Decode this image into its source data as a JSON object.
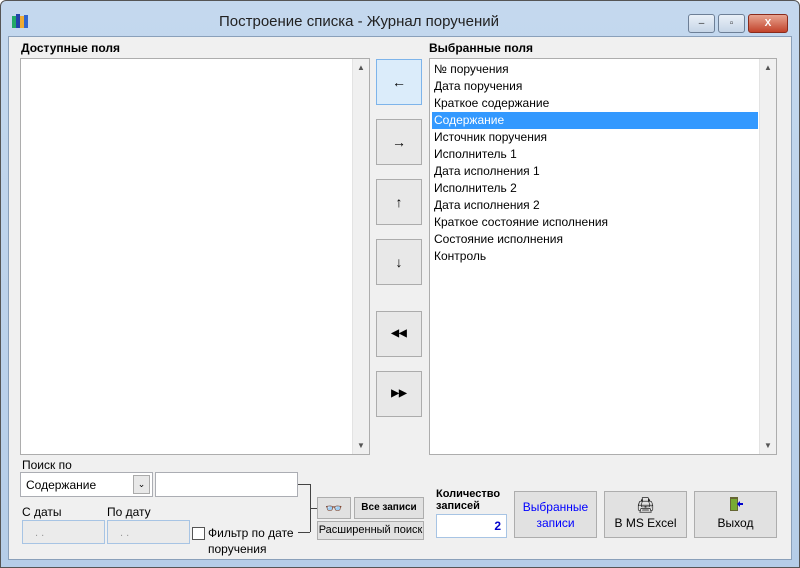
{
  "window": {
    "title": "Построение списка - Журнал поручений",
    "minimize": "–",
    "maximize": "▫",
    "close": "X"
  },
  "available": {
    "label": "Доступные поля",
    "items": []
  },
  "selected": {
    "label": "Выбранные поля",
    "items": [
      "№ поручения",
      "Дата поручения",
      "Краткое содержание",
      "Содержание",
      "Источник поручения",
      "Исполнитель 1",
      "Дата исполнения 1",
      "Исполнитель 2",
      "Дата исполнения 2",
      "Краткое состояние исполнения",
      "Состояние исполнения",
      "Контроль"
    ],
    "selected_index": 3
  },
  "arrows": {
    "add": "←",
    "remove": "→",
    "up": "↑",
    "down": "↓",
    "add_all": "◀◀",
    "remove_all": "▶▶"
  },
  "search": {
    "label": "Поиск по",
    "field_value": "Содержание",
    "text_value": "",
    "from_label": "С даты",
    "to_label": "По дату",
    "from_value": ". .",
    "to_value": ". .",
    "filter_label_1": "Фильтр по дате",
    "filter_label_2": "поручения",
    "filter_checked": false,
    "all_records": "Все записи",
    "advanced": "Расширенный поиск"
  },
  "count": {
    "label_1": "Количество",
    "label_2": "записей",
    "value": "2"
  },
  "buttons": {
    "selected_records_1": "Выбранные",
    "selected_records_2": "записи",
    "excel": "В MS Excel",
    "exit": "Выход"
  }
}
